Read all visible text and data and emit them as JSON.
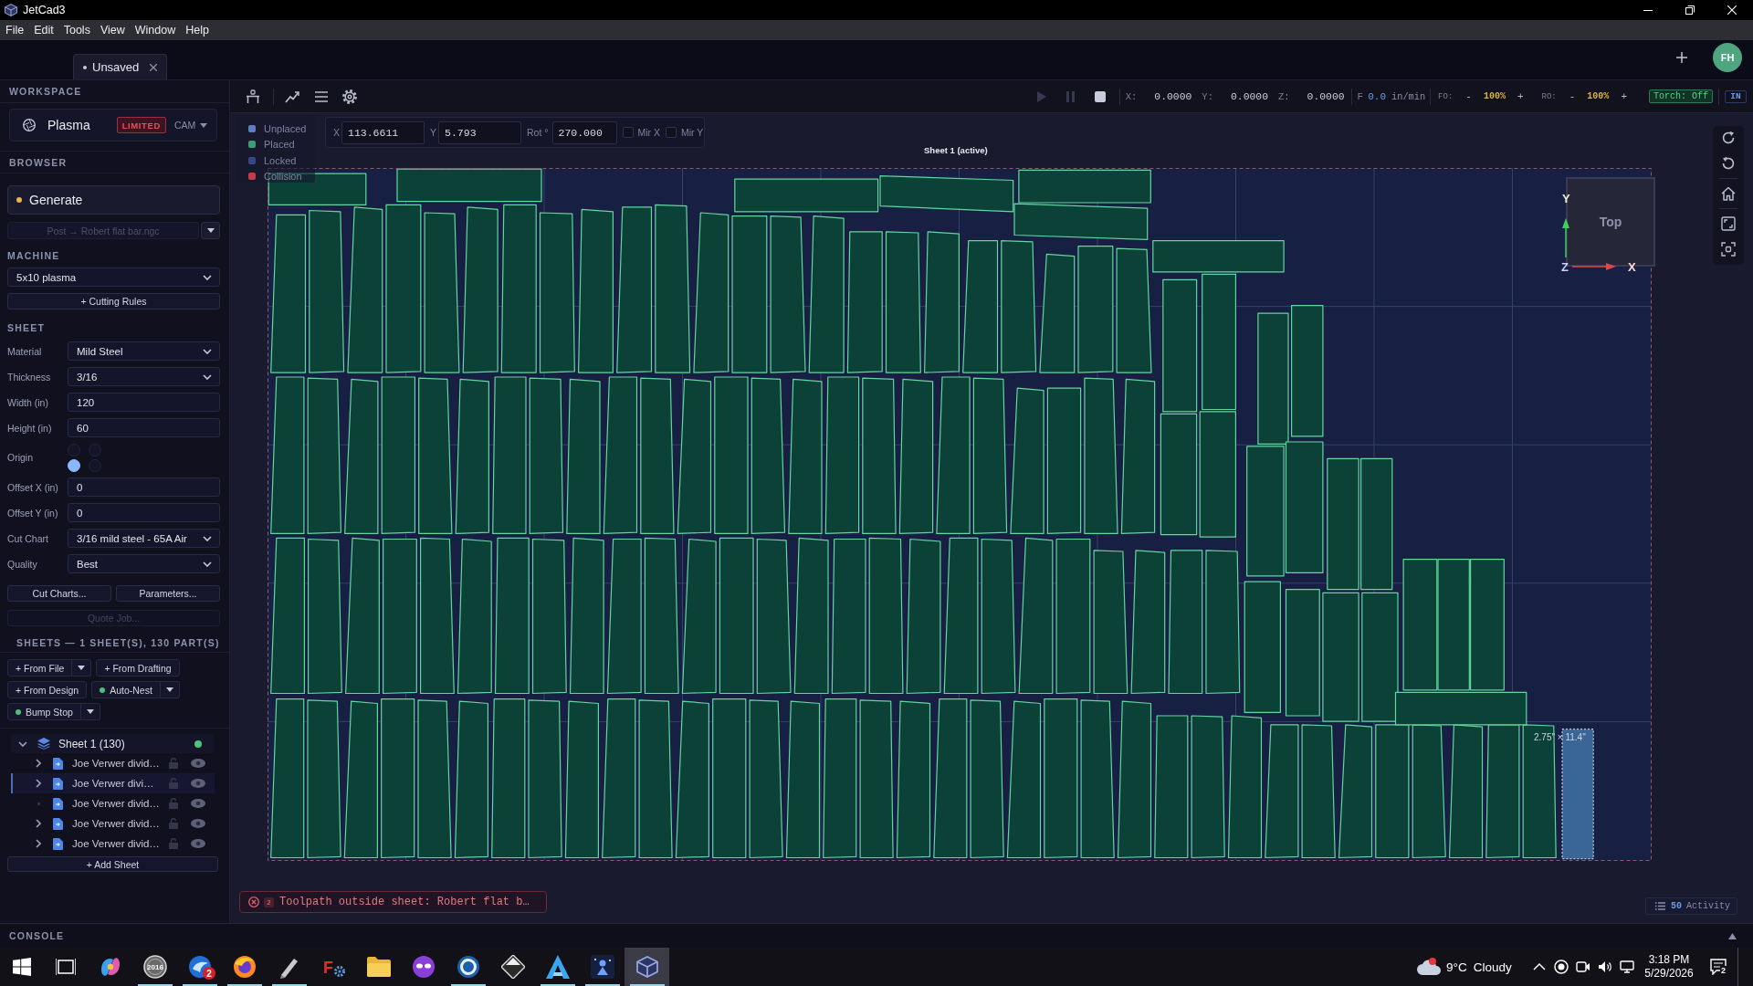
{
  "window": {
    "title": "JetCad3"
  },
  "menu": [
    "File",
    "Edit",
    "Tools",
    "View",
    "Window",
    "Help"
  ],
  "document_tabs": [
    {
      "label": "Unsaved",
      "modified": true,
      "selected": true
    }
  ],
  "user": {
    "initials": "FH"
  },
  "sidebar": {
    "workspace": {
      "heading": "WORKSPACE",
      "name": "Plasma",
      "badge": "LIMITED",
      "mode": "CAM"
    },
    "browser": {
      "heading": "BROWSER",
      "generate": "Generate",
      "post": {
        "label": "Post → Robert flat bar.ngc",
        "disabled": true
      }
    },
    "machine": {
      "heading": "MACHINE",
      "value": "5x10 plasma",
      "button": "+ Cutting Rules"
    },
    "sheet": {
      "heading": "SHEET",
      "fields": [
        {
          "kind": "select",
          "label": "Material",
          "value": "Mild Steel"
        },
        {
          "kind": "select",
          "label": "Thickness",
          "value": "3/16"
        },
        {
          "kind": "input",
          "label": "Width (in)",
          "value": "120"
        },
        {
          "kind": "input",
          "label": "Height (in)",
          "value": "60"
        },
        {
          "kind": "origin",
          "label": "Origin",
          "options": [
            {
              "selected": false
            },
            {
              "selected": false
            },
            {
              "selected": true
            },
            {
              "selected": false
            }
          ]
        },
        {
          "kind": "input",
          "label": "Offset X (in)",
          "value": "0"
        },
        {
          "kind": "input",
          "label": "Offset Y (in)",
          "value": "0"
        },
        {
          "kind": "select",
          "label": "Cut Chart",
          "value": "3/16 mild steel - 65A Air"
        },
        {
          "kind": "select",
          "label": "Quality",
          "value": "Best"
        }
      ],
      "buttons": [
        {
          "label": "Cut Charts...",
          "disabled": false
        },
        {
          "label": "Parameters...",
          "disabled": false
        },
        {
          "label": "Quote Job...",
          "disabled": true
        }
      ]
    },
    "sheets": {
      "heading": "SHEETS — 1 SHEET(S), 130 PART(S)",
      "actions": [
        {
          "label": "+ From File",
          "indicator": false,
          "split": true
        },
        {
          "label": "+ From Drafting",
          "indicator": false,
          "split": false
        },
        {
          "label": "+ From Design",
          "indicator": false,
          "split": false
        },
        {
          "label": "Auto-Nest",
          "indicator": true,
          "split": true
        },
        {
          "label": "Bump Stop",
          "indicator": true,
          "split": true
        }
      ],
      "tree": [
        {
          "label": "Sheet 1 (130)",
          "expanded": true,
          "active": true,
          "children": [
            {
              "kind": "group",
              "label": "Joe Verwer divid…",
              "expanded": false,
              "selected": false,
              "locked": false,
              "visible": true
            },
            {
              "kind": "group",
              "label": "Joe Verwer divi…",
              "expanded": false,
              "selected": true,
              "locked": false,
              "visible": true
            },
            {
              "kind": "item",
              "label": "Joe Verwer divid…",
              "selected": false,
              "locked": false,
              "visible": true
            },
            {
              "kind": "group",
              "label": "Joe Verwer divid…",
              "expanded": false,
              "selected": false,
              "locked": false,
              "visible": true
            },
            {
              "kind": "group",
              "label": "Joe Verwer divid…",
              "expanded": false,
              "selected": false,
              "locked": false,
              "visible": true
            }
          ]
        }
      ],
      "add_button": "+ Add Sheet"
    }
  },
  "toolbar": {
    "controls": [
      {
        "kind": "play",
        "disabled": true
      },
      {
        "kind": "pause",
        "disabled": true
      },
      {
        "kind": "stop",
        "disabled": false
      }
    ],
    "position": [
      {
        "axis": "X:",
        "value": "0.0000"
      },
      {
        "axis": "Y:",
        "value": "0.0000"
      },
      {
        "axis": "Z:",
        "value": "0.0000"
      }
    ],
    "feed": {
      "label": "F",
      "value": "0.0",
      "unit": "in/min"
    },
    "overrides": [
      {
        "label": "FO:",
        "decrease": "-",
        "value": "100%",
        "increase": "+"
      },
      {
        "label": "RO:",
        "decrease": "-",
        "value": "100%",
        "increase": "+"
      }
    ],
    "torch": "Torch: Off",
    "units": "IN"
  },
  "canvas": {
    "legend": [
      {
        "label": "Unplaced",
        "color": "#5b7fbf"
      },
      {
        "label": "Placed",
        "color": "#3f9a76"
      },
      {
        "label": "Locked",
        "color": "#3b4684"
      },
      {
        "label": "Collision",
        "color": "#c23b46"
      }
    ],
    "transform": {
      "fields": [
        {
          "label": "X",
          "value": "113.6611"
        },
        {
          "label": "Y",
          "value": "5.793"
        },
        {
          "label": "Rot °",
          "value": "270.000"
        }
      ],
      "mirror": [
        {
          "label": "Mir X",
          "checked": false
        },
        {
          "label": "Mir Y",
          "checked": false
        }
      ]
    },
    "sheet_label": "Sheet 1 (active)",
    "view_cube": {
      "face": "Top",
      "x_axis": "X",
      "y_axis": "Y",
      "z_axis": "Z"
    },
    "selection_size": "2.75\" × 11.4\"",
    "error": {
      "count": "2",
      "message": "Toolpath outside sheet: Robert flat b…"
    },
    "activity": {
      "count": "50",
      "label": "Activity"
    }
  },
  "console": {
    "label": "CONSOLE",
    "expanded": false
  },
  "taskbar": {
    "apps": [
      {
        "kind": "swirl",
        "running": false,
        "active": false
      },
      {
        "kind": "seal",
        "label": "2016",
        "running": true,
        "active": false
      },
      {
        "kind": "bird",
        "badge": "2",
        "running": true,
        "active": false
      },
      {
        "kind": "fox",
        "running": true,
        "active": false
      },
      {
        "kind": "pen",
        "running": true,
        "active": false
      },
      {
        "kind": "gear",
        "label": "F",
        "running": false,
        "active": false
      },
      {
        "kind": "folder",
        "running": false,
        "active": false
      },
      {
        "kind": "mask",
        "running": false,
        "active": false
      },
      {
        "kind": "ring",
        "running": true,
        "active": false
      },
      {
        "kind": "diamond",
        "running": false,
        "active": false
      },
      {
        "kind": "peak",
        "running": true,
        "active": false
      },
      {
        "kind": "starry",
        "running": true,
        "active": false
      },
      {
        "kind": "cube",
        "running": true,
        "active": true
      }
    ],
    "weather": {
      "temperature": "9°C",
      "condition": "Cloudy"
    },
    "clock": {
      "time": "3:18 PM",
      "date": "5/29/2026"
    },
    "notifications": "2"
  }
}
